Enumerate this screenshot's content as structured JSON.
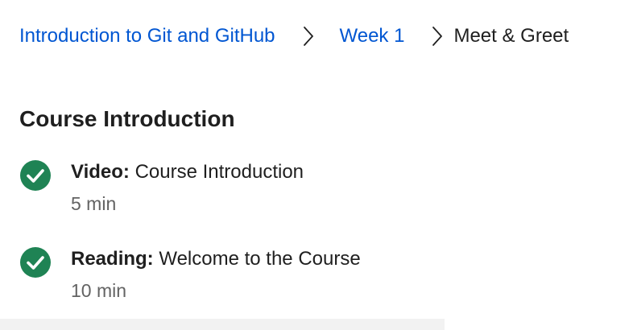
{
  "breadcrumb": {
    "course": "Introduction to Git and GitHub",
    "week": "Week 1",
    "current": "Meet & Greet"
  },
  "section": {
    "title": "Course Introduction",
    "items": [
      {
        "type": "Video:",
        "name": "Course Introduction",
        "duration": "5 min",
        "status": "completed"
      },
      {
        "type": "Reading:",
        "name": "Welcome to the Course",
        "duration": "10 min",
        "status": "completed"
      }
    ]
  },
  "colors": {
    "link": "#0056d2",
    "complete": "#1f8354",
    "text": "#1f1f1f",
    "muted": "#636363"
  },
  "icons": {
    "separator": "chevron-right-icon",
    "completed": "check-circle-icon"
  }
}
